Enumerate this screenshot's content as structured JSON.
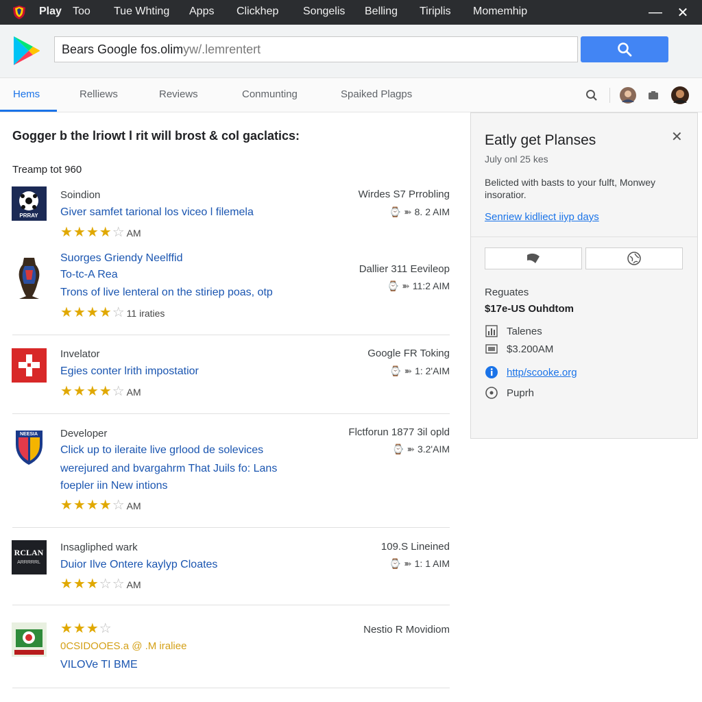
{
  "menubar": {
    "items": [
      "Play",
      "Too",
      "Tue Whting",
      "Apps",
      "Clickhep",
      "Songelis",
      "Belling",
      "Tiriplis",
      "Momemhip"
    ],
    "minimize": "—",
    "close": "✕"
  },
  "search": {
    "url_strong": "Bears Google fos.olim",
    "url_light": " yw/.lemrentert"
  },
  "tabs": {
    "items": [
      "Hems",
      "Relliews",
      "Reviews",
      "Conmunting",
      "Spaiked Plagps"
    ]
  },
  "main": {
    "heading": "Gogger b the lriowt l rit will brost & col gaclatics:",
    "subhead": "Treamp tot 960",
    "items": [
      {
        "category": "Soindion",
        "titles": [
          "Giver samfet tarional los viceo l filemela"
        ],
        "rating": 4,
        "rating_note": "AM",
        "right_top": "Wirdes S7 Prrobling",
        "right_bottom": "8. 2 AIM"
      },
      {
        "category": "",
        "titles": [
          "Suorges Griendy Neelffid",
          "To-tc-A Rea",
          "Trons of live lenteral on the stiriep poas, otp"
        ],
        "rating": 4,
        "rating_note": "11 iraties",
        "right_top": "Dallier 311 Eevileop",
        "right_bottom": "11:2 AIM"
      },
      {
        "category": "Invelator",
        "titles": [
          "Egies conter lrith impostatior"
        ],
        "rating": 4,
        "rating_note": "AM",
        "right_top": "Google FR Toking",
        "right_bottom": "1: 2'AIM"
      },
      {
        "category": "Developer",
        "titles": [
          "Click up to ileraite live grlood de solevices",
          "werejured and bvargahrm That Juils fo: Lans",
          "foepler iin New intions"
        ],
        "rating": 4,
        "rating_note": "AM",
        "right_top": "Flctforun 1877 3il opld",
        "right_bottom": "3.2'AIM"
      },
      {
        "category": "Insagliphed wark",
        "titles": [
          "Duior Ilve Ontere kaylyp Cloates"
        ],
        "rating": 3,
        "rating_note": "AM",
        "right_top": "109.S Lineined",
        "right_bottom": "1: 1 AIM"
      },
      {
        "category": "",
        "titles": [
          "0CSIDOOES.a @ .M iraliee",
          "VILOVe TI BME"
        ],
        "rating": 3,
        "rating_note": "",
        "right_top": "Nestio R Movidiom",
        "right_bottom": ""
      }
    ],
    "thumb_labels": [
      "PRRAY",
      "NEESIA",
      "RCLAN\nARRRRRL"
    ]
  },
  "panel": {
    "title": "Eatly get Planses",
    "date": "July onl 25 kes",
    "description": "Belicted with basts to your fulft, Monwey insoratior.",
    "link": "Senriew kidliect iiyp days",
    "label": "Reguates",
    "price": "$17e-US Ouhdtom",
    "rows": [
      {
        "icon": "chart-icon",
        "text": "Talenes"
      },
      {
        "icon": "tag-icon",
        "text": "$3.200AM"
      },
      {
        "icon": "info-icon",
        "text": "http/scooke.org"
      },
      {
        "icon": "target-icon",
        "text": "Puprh"
      }
    ]
  },
  "colors": {
    "accent": "#1a73e8",
    "menubar": "#2b2d30",
    "star": "#e0a800",
    "link": "#1a55b0"
  }
}
